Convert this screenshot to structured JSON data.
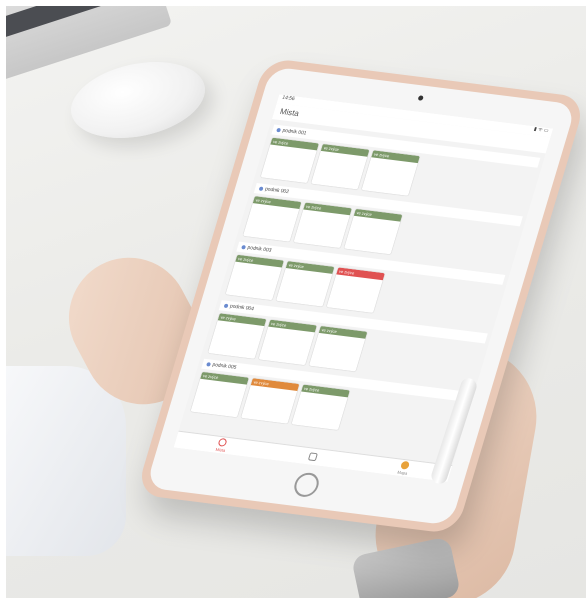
{
  "screen": {
    "status_left": "14:56",
    "status_right": "▮ ᯤ ▭",
    "title": "Mista"
  },
  "groups": [
    {
      "label": "podnik 001",
      "cards": [
        {
          "head": "ve zvýce",
          "color": "#7d9a6a"
        },
        {
          "head": "ve zvýce",
          "color": "#7d9a6a"
        },
        {
          "head": "ve zvýce",
          "color": "#7d9a6a"
        }
      ]
    },
    {
      "label": "podnik 002",
      "cards": [
        {
          "head": "ve zvýce",
          "color": "#7d9a6a"
        },
        {
          "head": "ve zvýce",
          "color": "#7d9a6a"
        },
        {
          "head": "ve zvýce",
          "color": "#7d9a6a"
        }
      ]
    },
    {
      "label": "podnik 003",
      "cards": [
        {
          "head": "ve zvýce",
          "color": "#7d9a6a"
        },
        {
          "head": "ve zvýce",
          "color": "#7d9a6a"
        },
        {
          "head": "ve zvýce",
          "color": "#e05252"
        }
      ]
    },
    {
      "label": "podnik 004",
      "cards": [
        {
          "head": "ve zvýce",
          "color": "#7d9a6a"
        },
        {
          "head": "ve zvýce",
          "color": "#7d9a6a"
        },
        {
          "head": "ve zvýce",
          "color": "#7d9a6a"
        }
      ]
    },
    {
      "label": "podnik 005",
      "cards": [
        {
          "head": "ve zvýce",
          "color": "#7d9a6a"
        },
        {
          "head": "ve zvýce",
          "color": "#e08a3c"
        },
        {
          "head": "ve zvýce",
          "color": "#7d9a6a"
        }
      ]
    }
  ],
  "tabs": [
    "Místa",
    "",
    "Mapa"
  ]
}
